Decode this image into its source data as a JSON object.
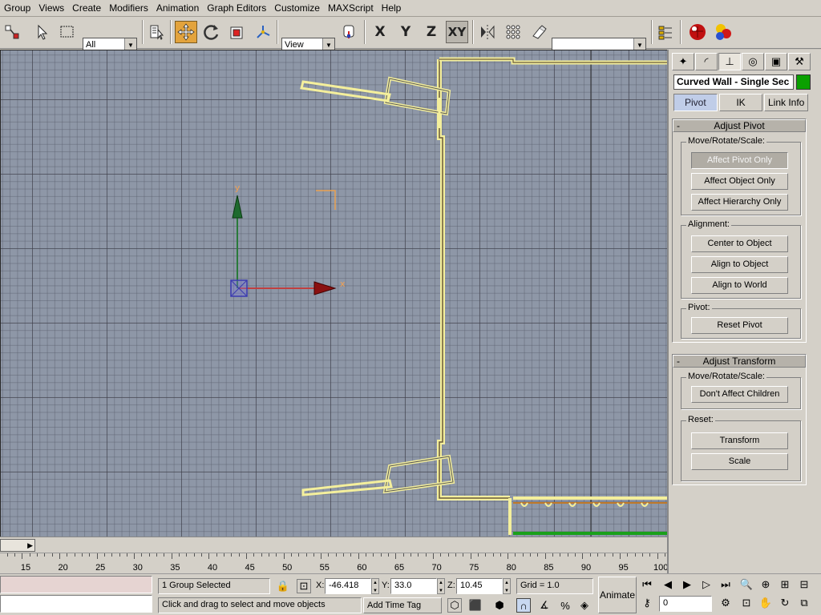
{
  "menu": [
    "Group",
    "Views",
    "Create",
    "Modifiers",
    "Animation",
    "Graph Editors",
    "Customize",
    "MAXScript",
    "Help"
  ],
  "toolbar": {
    "selection_filter": "All",
    "reference_coord": "View",
    "named_selection": "",
    "axis_x": "X",
    "axis_y": "Y",
    "axis_z": "Z",
    "axis_xy": "XY",
    "active_tool": "select-and-move",
    "accent_color": "#e3a33c"
  },
  "viewport": {
    "gizmo_y_label": "y",
    "gizmo_x_label": "x"
  },
  "trackbar": {
    "ticks": [
      "15",
      "20",
      "25",
      "30",
      "35",
      "40",
      "45",
      "50",
      "55",
      "60",
      "65",
      "70",
      "75",
      "80",
      "85",
      "90",
      "95",
      "100"
    ],
    "slider_value": ""
  },
  "status": {
    "selection": "1 Group Selected",
    "x_label": "X:",
    "x_value": "-46.418",
    "y_label": "Y:",
    "y_value": "33.0",
    "z_label": "Z:",
    "z_value": "10.45",
    "grid": "Grid = 1.0",
    "prompt": "Click and drag to select and move objects",
    "add_time_tag": "Add Time Tag",
    "animate": "Animate",
    "frame_value": "0"
  },
  "command_panel": {
    "object_name": "Curved Wall - Single Sec",
    "object_color": "#0aa000",
    "subtabs": [
      "Pivot",
      "IK",
      "Link Info"
    ],
    "active_subtab": "Pivot",
    "adjust_pivot": {
      "title": "Adjust Pivot",
      "move_group_label": "Move/Rotate/Scale:",
      "move_buttons": [
        "Affect Pivot Only",
        "Affect Object Only",
        "Affect Hierarchy Only"
      ],
      "alignment_label": "Alignment:",
      "alignment_buttons": [
        "Center to Object",
        "Align to Object",
        "Align to World"
      ],
      "pivot_label": "Pivot:",
      "reset_pivot": "Reset Pivot"
    },
    "adjust_transform": {
      "title": "Adjust Transform",
      "move_group_label": "Move/Rotate/Scale:",
      "dont_affect_children": "Don't Affect Children",
      "reset_label": "Reset:",
      "transform": "Transform",
      "scale": "Scale"
    }
  }
}
